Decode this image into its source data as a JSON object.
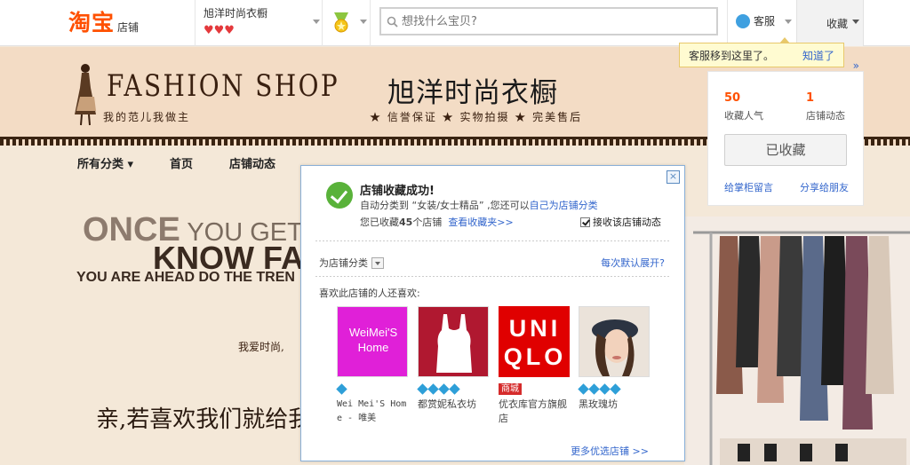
{
  "topbar": {
    "logo_main": "淘宝",
    "logo_sub": "店铺",
    "shop_name": "旭洋时尚衣橱",
    "hearts": "♥♥♥",
    "search_placeholder": "想找什么宝贝?",
    "service_label": "客服",
    "favorite_label": "收藏"
  },
  "tip": {
    "text": "客服移到这里了。",
    "dismiss": "知道了"
  },
  "banner": {
    "brand_en": "FASHION SHOP",
    "brand_slogan": "我的范儿我做主",
    "shop_title": "旭洋时尚衣橱",
    "guarantees": "★ 信誉保证  ★ 实物拍摄  ★ 完美售后"
  },
  "nav": {
    "items": [
      "所有分类",
      "首页",
      "店铺动态"
    ]
  },
  "hero": {
    "once_big": "ONCE",
    "once_small": " YOU GET",
    "know": "KNOW FA",
    "ahead": "YOU ARE AHEAD DO THE TREN",
    "love": "我爱时尚,",
    "bottom": "亲,若喜欢我们就给我"
  },
  "right_panel": {
    "stats": [
      {
        "num": "50",
        "label": "收藏人气"
      },
      {
        "num": "1",
        "label": "店铺动态"
      }
    ],
    "collected": "已收藏",
    "link_left": "给掌柜留言",
    "link_right": "分享给朋友",
    "chevron": "»"
  },
  "popup": {
    "title": "店铺收藏成功!",
    "line1_prefix": "自动分类到 “女装/女士精品” ,您还可以",
    "line1_link": "自己为店铺分类",
    "line2_prefix": "您已收藏",
    "line2_count": "45",
    "line2_suffix": "个店铺",
    "line2_link": "查看收藏夹>>",
    "receive": "接收该店铺动态",
    "category_label": "为店铺分类",
    "expand_label": "每次默认展开?",
    "likes_label": "喜欢此店铺的人还喜欢:",
    "more_label": "更多优选店铺 >>",
    "close": "×",
    "recommendations": [
      {
        "img_text": "WeiMei'S Home",
        "name": "Wei Mei'S Home - 唯美",
        "badge": "diamond",
        "count": 1
      },
      {
        "img_text": "",
        "name": "都赏妮私衣坊",
        "badge": "diamond",
        "count": 4
      },
      {
        "img_text": "UNI QLO",
        "name": "优衣库官方旗舰店",
        "badge": "tmall",
        "tag": "商城"
      },
      {
        "img_text": "",
        "name": "黑玫瑰坊",
        "badge": "diamond",
        "count": 4
      }
    ]
  }
}
